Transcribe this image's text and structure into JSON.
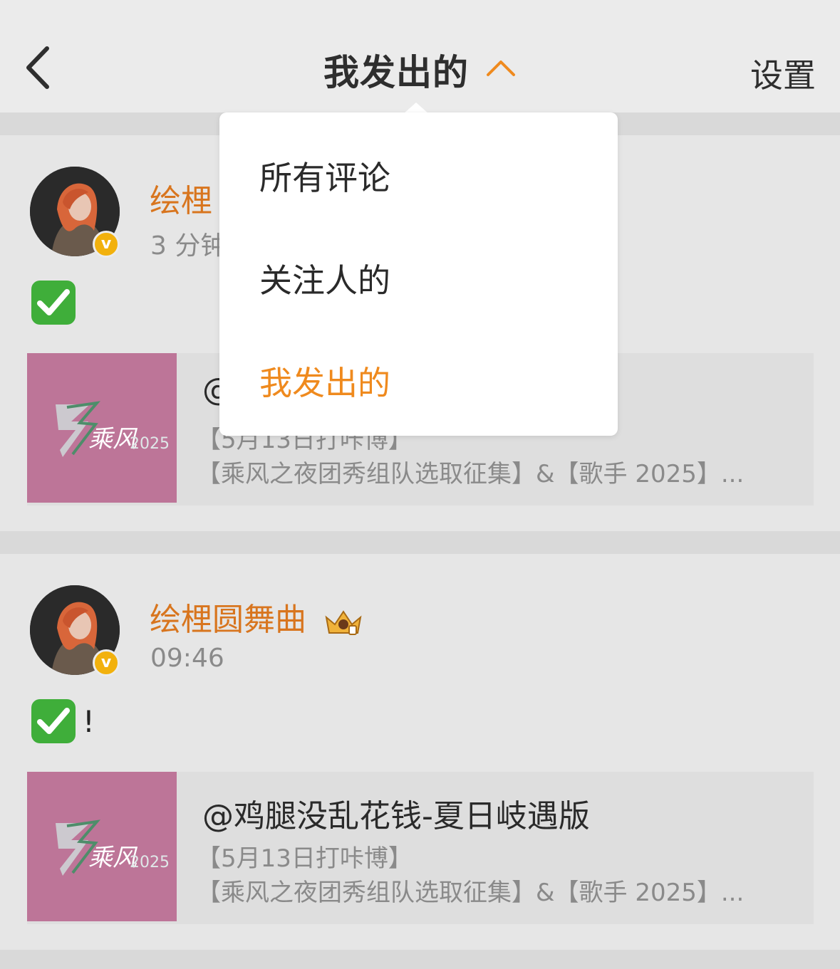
{
  "header": {
    "title": "我发出的",
    "settings_label": "设置"
  },
  "colors": {
    "accent": "#ef8a1e",
    "username": "#d8751e",
    "verified_badge": "#f2b10d",
    "thumbnail_bg": "#bd7598"
  },
  "dropdown": {
    "items": [
      {
        "label": "所有评论",
        "active": false
      },
      {
        "label": "关注人的",
        "active": false
      },
      {
        "label": "我发出的",
        "active": true
      }
    ]
  },
  "comments": [
    {
      "username": "绘梩圆舞曲",
      "visible_username": "绘梩",
      "time": "3 分钟",
      "text_icon": "check-mark-emoji",
      "text": "",
      "quote": {
        "title": "@",
        "line1": "【5月13日打咔博】",
        "line2": "【乘风之夜团秀组队选取征集】&【歌手 2025】..."
      }
    },
    {
      "username": "绘梩圆舞曲",
      "badge_icon": "crown-icon",
      "time": "09:46",
      "text_icon": "check-mark-emoji",
      "text": "!",
      "quote": {
        "title": "@鸡腿没乱花钱-夏日岐遇版",
        "line1": "【5月13日打咔博】",
        "line2": "【乘风之夜团秀组队选取征集】&【歌手 2025】..."
      }
    }
  ]
}
